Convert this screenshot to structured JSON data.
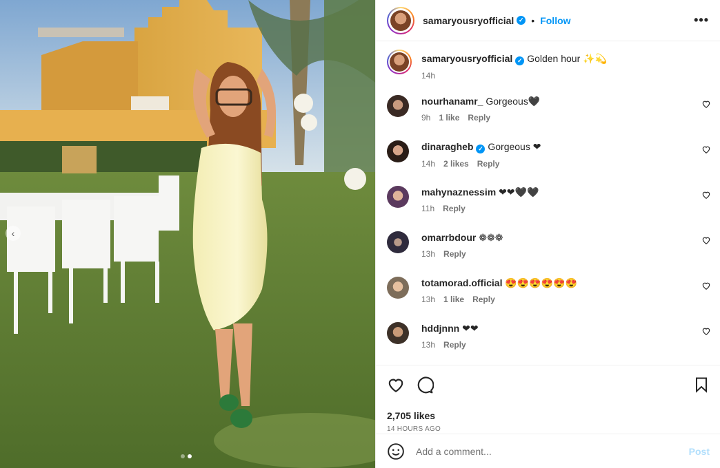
{
  "post": {
    "author": "samaryousryofficial",
    "follow_label": "Follow",
    "separator": "•",
    "more_label": "•••",
    "caption": "Golden hour ✨💫",
    "caption_time": "14h"
  },
  "comments": [
    {
      "user": "nourhanamr_",
      "text": "Gorgeous🖤",
      "time": "9h",
      "likes": "1 like",
      "reply": "Reply",
      "verified": false
    },
    {
      "user": "dinaragheb",
      "text": "Gorgeous ❤",
      "time": "14h",
      "likes": "2 likes",
      "reply": "Reply",
      "verified": true
    },
    {
      "user": "mahynaznessim",
      "text": "❤❤🖤🖤",
      "time": "11h",
      "likes": "",
      "reply": "Reply",
      "verified": false
    },
    {
      "user": "omarrbdour",
      "text": "❁❁❁",
      "time": "13h",
      "likes": "",
      "reply": "Reply",
      "verified": false
    },
    {
      "user": "totamorad.official",
      "text": "😍😍😍😍😍😍",
      "time": "13h",
      "likes": "1 like",
      "reply": "Reply",
      "verified": false
    },
    {
      "user": "hddjnnn",
      "text": "❤❤",
      "time": "13h",
      "likes": "",
      "reply": "Reply",
      "verified": false
    }
  ],
  "footer": {
    "likes": "2,705 likes",
    "posted": "14 HOURS AGO",
    "comment_placeholder": "Add a comment...",
    "post_label": "Post"
  },
  "colors": {
    "accent": "#0095f6",
    "muted": "#737373",
    "post_disabled": "#b2dffc"
  },
  "carousel": {
    "index": 2,
    "count": 2
  }
}
